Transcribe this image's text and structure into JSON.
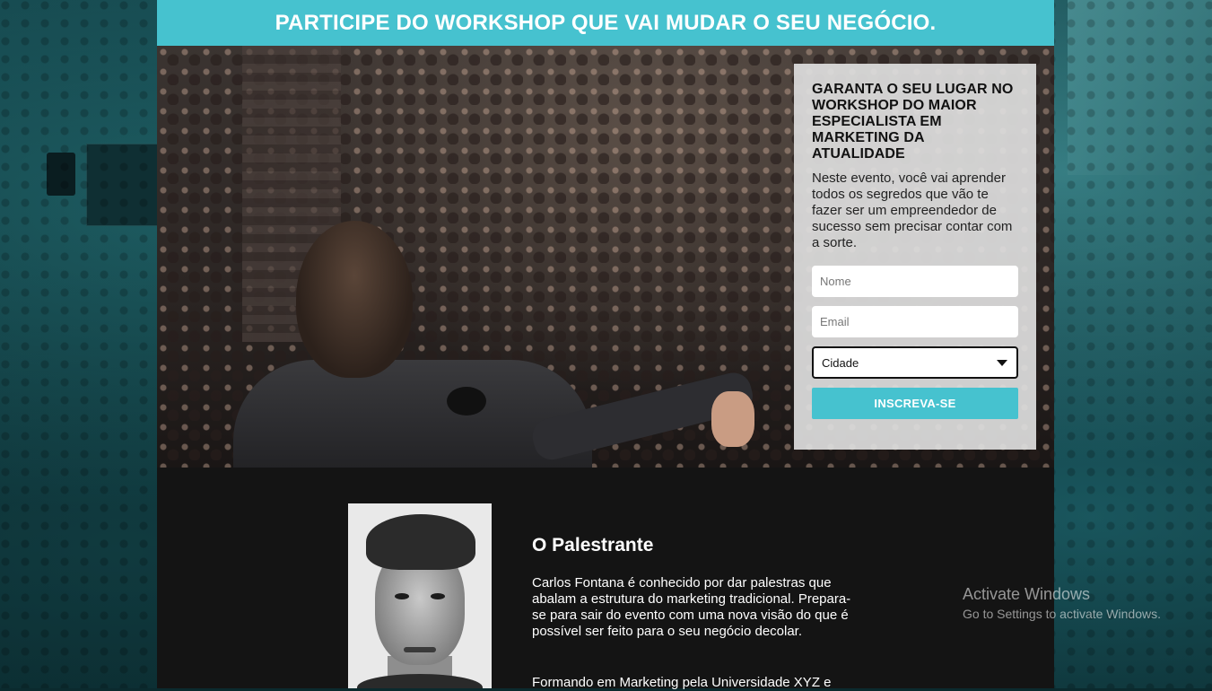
{
  "banner": {
    "title": "PARTICIPE DO WORKSHOP QUE VAI MUDAR O SEU NEGÓCIO."
  },
  "form": {
    "title": "GARANTA O SEU LUGAR NO WORKSHOP DO MAIOR ESPECIALISTA EM MARKETING DA ATUALIDADE",
    "description": "Neste evento, você vai aprender todos os segredos que vão te fazer ser um empreendedor de sucesso sem precisar contar com a sorte.",
    "name_placeholder": "Nome",
    "email_placeholder": "Email",
    "city_selected": "Cidade",
    "submit_label": "INSCREVA-SE"
  },
  "speaker": {
    "heading": "O Palestrante",
    "paragraph1": "Carlos Fontana é conhecido por dar palestras que abalam a estrutura do marketing tradicional. Prepara-se para sair do evento com uma nova visão do que é possível ser feito para o seu negócio decolar.",
    "paragraph2": "Formando em Marketing pela Universidade XYZ e"
  },
  "watermark": {
    "title": "Activate Windows",
    "subtitle": "Go to Settings to activate Windows."
  },
  "colors": {
    "accent": "#46c2cf",
    "dark_section": "#141414",
    "form_background": "#dedede"
  }
}
